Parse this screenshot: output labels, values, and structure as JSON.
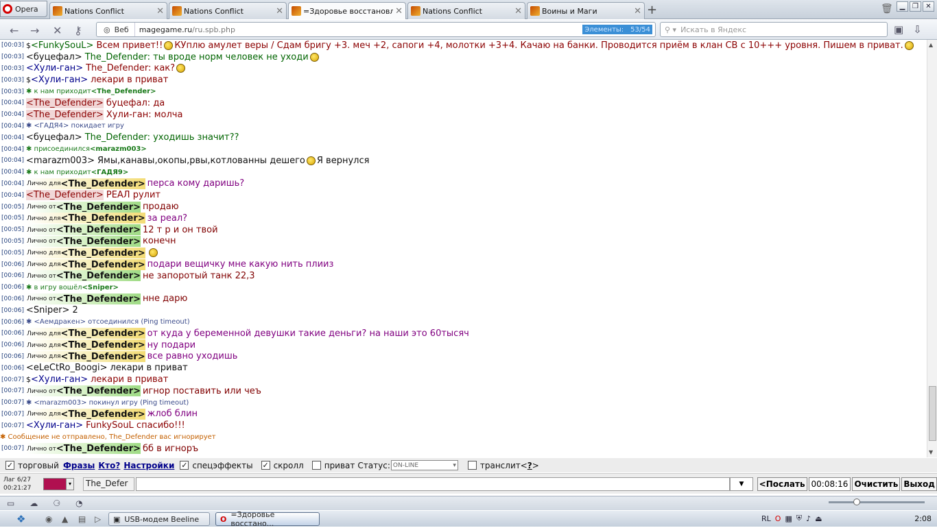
{
  "browser": {
    "menu_label": "Opera",
    "tabs": [
      {
        "title": "Nations Conflict"
      },
      {
        "title": "Nations Conflict"
      },
      {
        "title": "=Здоровье восстановл..."
      },
      {
        "title": "Nations Conflict"
      },
      {
        "title": "Воины и Маги"
      }
    ],
    "address": {
      "web_label": "Веб",
      "domain": "magegame.ru",
      "path": "/ru.spb.php",
      "elements_label": "Элементы:",
      "elements_count": "53/54"
    },
    "search_placeholder": "Искать в Яндекс"
  },
  "chat": {
    "colors": {
      "timestamp": "#1f3d7a",
      "nick_red": "#8b0000",
      "nick_blue": "#00008b",
      "nick_green": "#006400",
      "text_green": "#006400",
      "text_red": "#8b0000",
      "text_blue": "#00008b",
      "pm_purple": "#800080",
      "pm_maroon": "#800000",
      "system_green": "#1a7a1a",
      "system_blue": "#3a4a8a",
      "warning_orange": "#c46000"
    },
    "lines": [
      {
        "ts": "[00:03]",
        "pre": "$ ",
        "nick": "<FunkySouL>",
        "nick_color": "#006400",
        "text": "Всем привет!! ",
        "text_color": "#8b0000",
        "icon": true,
        "text2": " КУплю амулет веры / Сдам бригу +3. меч +2, сапоги +4, молотки +3+4. Качаю на банки. Проводится приём в клан СВ с 10+++ уровня. Пишем в приват. ",
        "icon2": true
      },
      {
        "ts": "[00:03]",
        "nick": "<буцефал>",
        "nick_color": "#111",
        "text": "The_Defender: ты вроде норм человек не уходи",
        "text_color": "#006400",
        "icon": true
      },
      {
        "ts": "[00:03]",
        "nick": "<Хули-ган>",
        "nick_color": "#00008b",
        "text": "The_Defender: как?",
        "text_color": "#8b0000",
        "icon": true
      },
      {
        "ts": "[00:03]",
        "pre": "$ ",
        "nick": "<Хули-ган>",
        "nick_color": "#00008b",
        "text": "лекари в приват",
        "text_color": "#8b0000"
      },
      {
        "ts": "[00:03]",
        "sys": "✱ к нам приходит ",
        "sys_nick": "<The_Defender>",
        "sys_color": "#1a7a1a"
      },
      {
        "ts": "[00:04]",
        "nick": "<The_Defender>",
        "nick_color": "#8b0000",
        "nick_bg": "#f1d7d7",
        "text": "буцефал: да",
        "text_color": "#8b0000"
      },
      {
        "ts": "[00:04]",
        "nick": "<The_Defender>",
        "nick_color": "#8b0000",
        "nick_bg": "#f1d7d7",
        "text": "Хули-ган: молча",
        "text_color": "#8b0000"
      },
      {
        "ts": "[00:04]",
        "sys": "✱ <ГАДЯ4> покидает игру",
        "sys_color": "#3a4a8a"
      },
      {
        "ts": "[00:04]",
        "nick": "<буцефал>",
        "nick_color": "#111",
        "text": "The_Defender: уходишь значит??",
        "text_color": "#006400"
      },
      {
        "ts": "[00:04]",
        "sys": "✱ присоединился ",
        "sys_nick": "<marazm003>",
        "sys_color": "#1a7a1a"
      },
      {
        "ts": "[00:04]",
        "nick": "<marazm003>",
        "nick_color": "#111",
        "text": "Ямы,канавы,окопы,рвы,котлованны дешего",
        "text_color": "#111",
        "icon": true,
        "text2": " Я вернулся"
      },
      {
        "ts": "[00:04]",
        "sys": "✱ к нам приходит ",
        "sys_nick": "<ГАДЯ9>",
        "sys_color": "#1a7a1a"
      },
      {
        "ts": "[00:04]",
        "pm": "Лично для ",
        "pm_type": "for",
        "nick": "<The_Defender>",
        "text": "перса кому даришь?",
        "text_color": "#800080"
      },
      {
        "ts": "[00:04]",
        "nick": "<The_Defender>",
        "nick_color": "#8b0000",
        "nick_bg": "#f1d7d7",
        "text": "РЕАЛ рулит",
        "text_color": "#8b0000"
      },
      {
        "ts": "[00:05]",
        "pm": "Лично от ",
        "pm_type": "from",
        "nick": "<The_Defender>",
        "text": "продаю",
        "text_color": "#800000"
      },
      {
        "ts": "[00:05]",
        "pm": "Лично для ",
        "pm_type": "for",
        "nick": "<The_Defender>",
        "text": "за реал?",
        "text_color": "#800080"
      },
      {
        "ts": "[00:05]",
        "pm": "Лично от ",
        "pm_type": "from",
        "nick": "<The_Defender>",
        "text": "12 т р и он твой",
        "text_color": "#800000"
      },
      {
        "ts": "[00:05]",
        "pm": "Лично от ",
        "pm_type": "from",
        "nick": "<The_Defender>",
        "text": "конечн",
        "text_color": "#800000"
      },
      {
        "ts": "[00:05]",
        "pm": "Лично для ",
        "pm_type": "for",
        "nick": "<The_Defender>",
        "text": "",
        "text_color": "#800080",
        "icon": true
      },
      {
        "ts": "[00:06]",
        "pm": "Лично для ",
        "pm_type": "for",
        "nick": "<The_Defender>",
        "text": "подари вещичку мне какую нить плииз",
        "text_color": "#800080"
      },
      {
        "ts": "[00:06]",
        "pm": "Лично от ",
        "pm_type": "from",
        "nick": "<The_Defender>",
        "text": "не запоротый танк 22,3",
        "text_color": "#800000"
      },
      {
        "ts": "[00:06]",
        "sys": "✱ в игру вошёл ",
        "sys_nick": "<Sniper>",
        "sys_color": "#1a7a1a"
      },
      {
        "ts": "[00:06]",
        "pm": "Лично от ",
        "pm_type": "from",
        "nick": "<The_Defender>",
        "text": "нне дарю",
        "text_color": "#800000"
      },
      {
        "ts": "[00:06]",
        "nick": "<Sniper>",
        "nick_color": "#111",
        "text": "2",
        "text_color": "#111"
      },
      {
        "ts": "[00:06]",
        "sys": "✱ <Аемдракен> отсоединился (Ping timeout)",
        "sys_color": "#3a4a8a"
      },
      {
        "ts": "[00:06]",
        "pm": "Лично для ",
        "pm_type": "for",
        "nick": "<The_Defender>",
        "text": "от куда у беременной девушки такие деньги? на наши это 60тысяч",
        "text_color": "#800080"
      },
      {
        "ts": "[00:06]",
        "pm": "Лично для ",
        "pm_type": "for",
        "nick": "<The_Defender>",
        "text": "ну подари",
        "text_color": "#800080"
      },
      {
        "ts": "[00:06]",
        "pm": "Лично для ",
        "pm_type": "for",
        "nick": "<The_Defender>",
        "text": "все равно уходишь",
        "text_color": "#800080"
      },
      {
        "ts": "[00:06]",
        "nick": "<eLeCtRo_Boogi>",
        "nick_color": "#111",
        "text": "лекари в приват",
        "text_color": "#111"
      },
      {
        "ts": "[00:07]",
        "pre": "$ ",
        "nick": "<Хули-ган>",
        "nick_color": "#00008b",
        "text": "лекари в приват",
        "text_color": "#8b0000"
      },
      {
        "ts": "[00:07]",
        "pm": "Лично от ",
        "pm_type": "from",
        "nick": "<The_Defender>",
        "text": "игнор поставить или чеъ",
        "text_color": "#800000"
      },
      {
        "ts": "[00:07]",
        "sys": "✱ <marazm003> покинул игру (Ping timeout)",
        "sys_color": "#3a4a8a"
      },
      {
        "ts": "[00:07]",
        "pm": "Лично для ",
        "pm_type": "for",
        "nick": "<The_Defender>",
        "text": "жлоб блин",
        "text_color": "#800080"
      },
      {
        "ts": "[00:07]",
        "nick": "<Хули-ган>",
        "nick_color": "#00008b",
        "text": "FunkySouL спасибо!!!",
        "text_color": "#8b0000"
      },
      {
        "ts": "",
        "sys": "✱ Сообщение не отправлено, The_Defender вас игнорирует",
        "sys_color": "#c46000"
      },
      {
        "ts": "[00:07]",
        "pm": "Лично от ",
        "pm_type": "from",
        "nick": "<The_Defender>",
        "text": "бб в игноръ",
        "text_color": "#800000"
      }
    ]
  },
  "controls": {
    "trade_label": "торговый",
    "phrases_link": "Фразы",
    "who_link": "Кто?",
    "settings_link": "Настройки",
    "effects_label": "спецэффекты",
    "scroll_label": "скролл",
    "private_label": "приват",
    "status_label": "Статус:",
    "status_value": "ON-LINE",
    "translit_label": "транслит<",
    "translit_help": "?",
    "translit_end": ">",
    "trade_checked": true,
    "effects_checked": true,
    "scroll_checked": true,
    "private_checked": false,
    "translit_checked": false
  },
  "input": {
    "lag": "Лаг 6/27",
    "clock": "00:21:27",
    "color": "#b01050",
    "nick": "The_Defer",
    "send": "<Послать",
    "timer": "00:08:16",
    "clear": "Очистить",
    "exit": "Выход"
  },
  "taskbar": {
    "tasks": [
      {
        "label": "USB-модем Beeline"
      },
      {
        "label": "=Здоровье восстано..."
      }
    ],
    "lang": "RL",
    "time": "2:08"
  }
}
